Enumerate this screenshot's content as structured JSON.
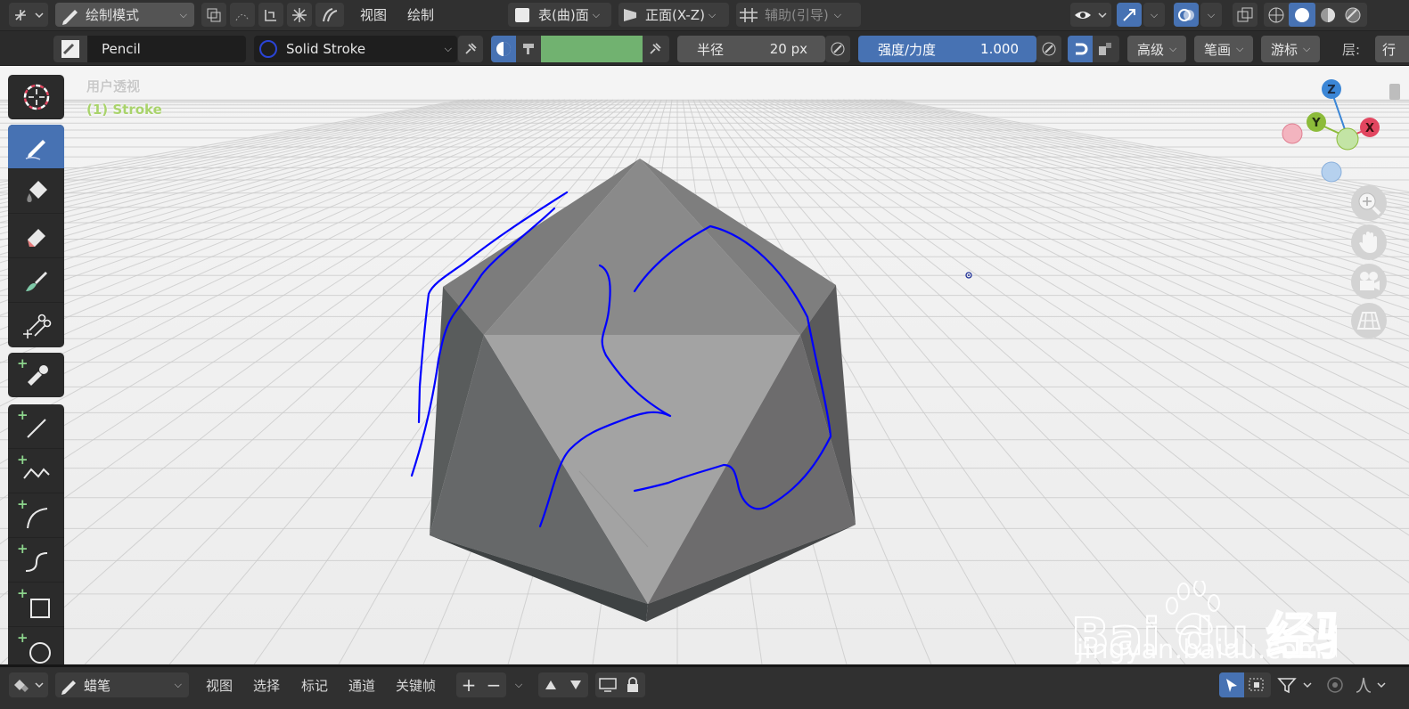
{
  "header": {
    "mode_label": "绘制模式",
    "menus": [
      "视图",
      "绘制"
    ],
    "surface_label": "表(曲)面",
    "orientation_label": "正面(X-Z)",
    "guides_label": "辅助(引导)"
  },
  "tool_settings": {
    "brush_name": "Pencil",
    "material_name": "Solid Stroke",
    "material_color": "#71b270",
    "radius_label": "半径",
    "radius_value": "20 px",
    "strength_label": "强度/力度",
    "strength_value": "1.000",
    "advanced_label": "高级",
    "stroke_label": "笔画",
    "cursor_label": "游标",
    "layer_label": "层:",
    "row_label": "行"
  },
  "viewport": {
    "view_name": "用户透视",
    "object_name": "(1) Stroke",
    "axes": [
      "Z",
      "Y",
      "X"
    ],
    "stroke_color": "#0000ff"
  },
  "left_tools": [
    {
      "name": "cursor-tool",
      "icon": "cursor-icon"
    },
    {
      "name": "draw-tool",
      "icon": "pencil-icon",
      "active": true
    },
    {
      "name": "fill-tool",
      "icon": "fill-bucket-icon"
    },
    {
      "name": "erase-tool",
      "icon": "eraser-icon"
    },
    {
      "name": "tint-tool",
      "icon": "brush-icon"
    },
    {
      "name": "cutter-tool",
      "icon": "scissors-icon"
    },
    {
      "name": "eyedropper-tool",
      "icon": "eyedropper-icon"
    },
    {
      "name": "line-tool",
      "icon": "line-icon"
    },
    {
      "name": "polyline-tool",
      "icon": "polyline-icon"
    },
    {
      "name": "arc-tool",
      "icon": "arc-icon"
    },
    {
      "name": "curve-tool",
      "icon": "curve-icon"
    },
    {
      "name": "box-tool",
      "icon": "box-icon"
    },
    {
      "name": "circle-tool",
      "icon": "circle-icon"
    }
  ],
  "bottom_bar": {
    "mode_label": "蜡笔",
    "menus": [
      "视图",
      "选择",
      "标记",
      "通道",
      "关键帧"
    ]
  },
  "watermark": {
    "text": "Bai du 经验",
    "url": "jingyan.baidu.com"
  }
}
